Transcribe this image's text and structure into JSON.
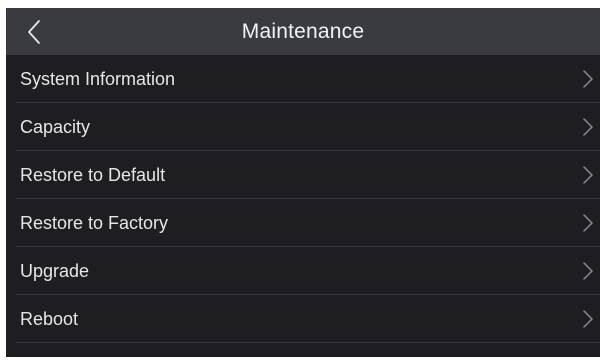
{
  "header": {
    "title": "Maintenance",
    "back_icon": "chevron-left-icon"
  },
  "menu": {
    "items": [
      {
        "label": "System Information",
        "icon": "chevron-right-icon"
      },
      {
        "label": "Capacity",
        "icon": "chevron-right-icon"
      },
      {
        "label": "Restore to Default",
        "icon": "chevron-right-icon"
      },
      {
        "label": "Restore to Factory",
        "icon": "chevron-right-icon"
      },
      {
        "label": "Upgrade",
        "icon": "chevron-right-icon"
      },
      {
        "label": "Reboot",
        "icon": "chevron-right-icon"
      }
    ]
  },
  "colors": {
    "header_bg": "#3a3b41",
    "panel_bg": "#1e1e22",
    "text": "#e6e6e6",
    "divider": "#3a3a40",
    "chevron": "#8a8a90"
  }
}
